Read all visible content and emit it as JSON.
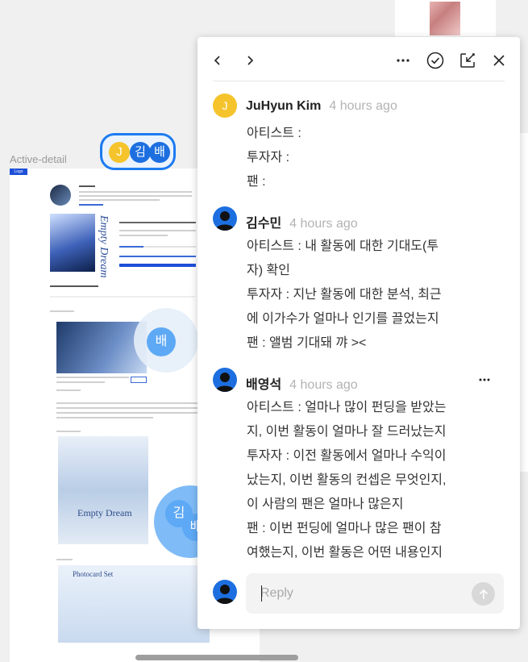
{
  "canvas": {
    "frame_label": "Active-detail",
    "logo_chip": "Logo",
    "album_title_vertical": "Empty Dream",
    "poster_title": "Empty Dream",
    "photocard_title": "Photocard Set",
    "section_bubble_label": "배",
    "section_bubble_label2": "김",
    "section_bubble_label3": "배"
  },
  "presence": {
    "users": [
      {
        "initial": "J",
        "color": "#f5c42c"
      },
      {
        "initial": "김",
        "color": "#1d6fe0"
      },
      {
        "initial": "배",
        "color": "#1d6fe0"
      }
    ]
  },
  "toolbar": {
    "prev_icon": "chevron-left-icon",
    "next_icon": "chevron-right-icon",
    "more_icon": "more-horizontal-icon",
    "resolve_icon": "check-circle-icon",
    "expand_icon": "expand-arrow-icon",
    "close_icon": "close-icon"
  },
  "comments": [
    {
      "initial": "J",
      "author": "JuHyun Kim",
      "time": "4 hours ago",
      "body": "아티스트 :\n투자자 :\n팬 :"
    },
    {
      "initial": "",
      "author": "김수민",
      "time": "4 hours ago",
      "body": "아티스트 : 내 활동에 대한 기대도(투\n자) 확인\n투자자 : 지난 활동에 대한 분석, 최근\n에 이가수가 얼마나 인기를 끌었는지\n팬 : 앨범 기대돼 꺄 ><"
    },
    {
      "initial": "",
      "author": "배영석",
      "time": "4 hours ago",
      "body": "아티스트 : 얼마나 많이 펀딩을 받았는\n지, 이번 활동이 얼마나 잘 드러났는지\n투자자 : 이전 활동에서 얼마나 수익이\n났는지, 이번 활동의 컨셉은 무엇인지,\n이 사람의 팬은 얼마나 많은지\n팬 : 이번 펀딩에 얼마나 많은 팬이 참\n여했는지, 이번 활동은 어떤 내용인지"
    }
  ],
  "reply": {
    "placeholder": "Reply",
    "value": ""
  }
}
